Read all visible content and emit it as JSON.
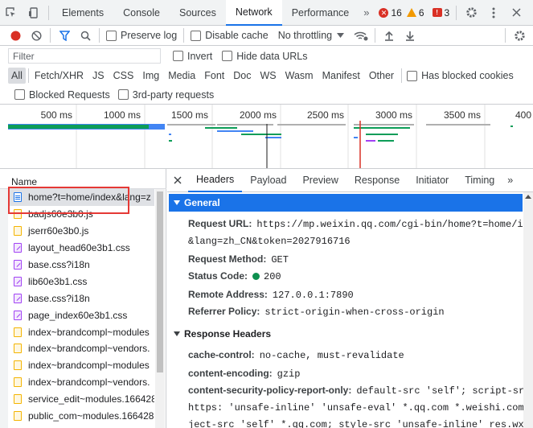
{
  "top_tabs": [
    "Elements",
    "Console",
    "Sources",
    "Network",
    "Performance"
  ],
  "active_top_tab": "Network",
  "more_tabs": "»",
  "counts": {
    "errors": "16",
    "warnings": "6",
    "issues": "3"
  },
  "toolbar": {
    "preserve_log": "Preserve log",
    "disable_cache": "Disable cache",
    "throttling": "No throttling"
  },
  "filter": {
    "placeholder": "Filter",
    "invert": "Invert",
    "hide_data_urls": "Hide data URLs"
  },
  "types": [
    "All",
    "Fetch/XHR",
    "JS",
    "CSS",
    "Img",
    "Media",
    "Font",
    "Doc",
    "WS",
    "Wasm",
    "Manifest",
    "Other"
  ],
  "has_blocked_cookies": "Has blocked cookies",
  "blocked_requests": "Blocked Requests",
  "third_party": "3rd-party requests",
  "timeline_ticks": [
    "500 ms",
    "1000 ms",
    "1500 ms",
    "2000 ms",
    "2500 ms",
    "3000 ms",
    "3500 ms",
    "400"
  ],
  "list": {
    "header": "Name",
    "rows": [
      {
        "name": "home?t=home/index&lang=z",
        "kind": "doc"
      },
      {
        "name": "badjs60e3b0.js",
        "kind": "js"
      },
      {
        "name": "jserr60e3b0.js",
        "kind": "js"
      },
      {
        "name": "layout_head60e3b1.css",
        "kind": "css"
      },
      {
        "name": "base.css?i18n",
        "kind": "css"
      },
      {
        "name": "lib60e3b1.css",
        "kind": "css"
      },
      {
        "name": "base.css?i18n",
        "kind": "css"
      },
      {
        "name": "page_index60e3b1.css",
        "kind": "css"
      },
      {
        "name": "index~brandcompl~modules",
        "kind": "js"
      },
      {
        "name": "index~brandcompl~vendors.",
        "kind": "js"
      },
      {
        "name": "index~brandcompl~modules",
        "kind": "js"
      },
      {
        "name": "index~brandcompl~vendors.",
        "kind": "js"
      },
      {
        "name": "service_edit~modules.166428",
        "kind": "js"
      },
      {
        "name": "public_com~modules.166428",
        "kind": "js"
      }
    ]
  },
  "detail_tabs": [
    "Headers",
    "Payload",
    "Preview",
    "Response",
    "Initiator",
    "Timing"
  ],
  "general": {
    "title": "General",
    "request_url_label": "Request URL:",
    "request_url_1": "https://mp.weixin.qq.com/cgi-bin/home?t=home/index",
    "request_url_2": "&lang=zh_CN&token=2027916716",
    "method_label": "Request Method:",
    "method": "GET",
    "status_label": "Status Code:",
    "status": "200",
    "remote_label": "Remote Address:",
    "remote": "127.0.0.1:7890",
    "referrer_label": "Referrer Policy:",
    "referrer": "strict-origin-when-cross-origin"
  },
  "response_headers": {
    "title": "Response Headers",
    "cache_label": "cache-control:",
    "cache": "no-cache, must-revalidate",
    "encoding_label": "content-encoding:",
    "encoding": "gzip",
    "csp_label": "content-security-policy-report-only:",
    "csp_1": "default-src 'self'; script-src",
    "csp_2": "https: 'unsafe-inline' 'unsafe-eval' *.qq.com *.weishi.com; ob",
    "csp_3": "ject-src 'self' *.qq.com; style-src 'unsafe-inline' res.wx.qq."
  },
  "colors": {
    "accent": "#1a73e8",
    "record": "#d93025",
    "status_ok": "#0d904f"
  }
}
